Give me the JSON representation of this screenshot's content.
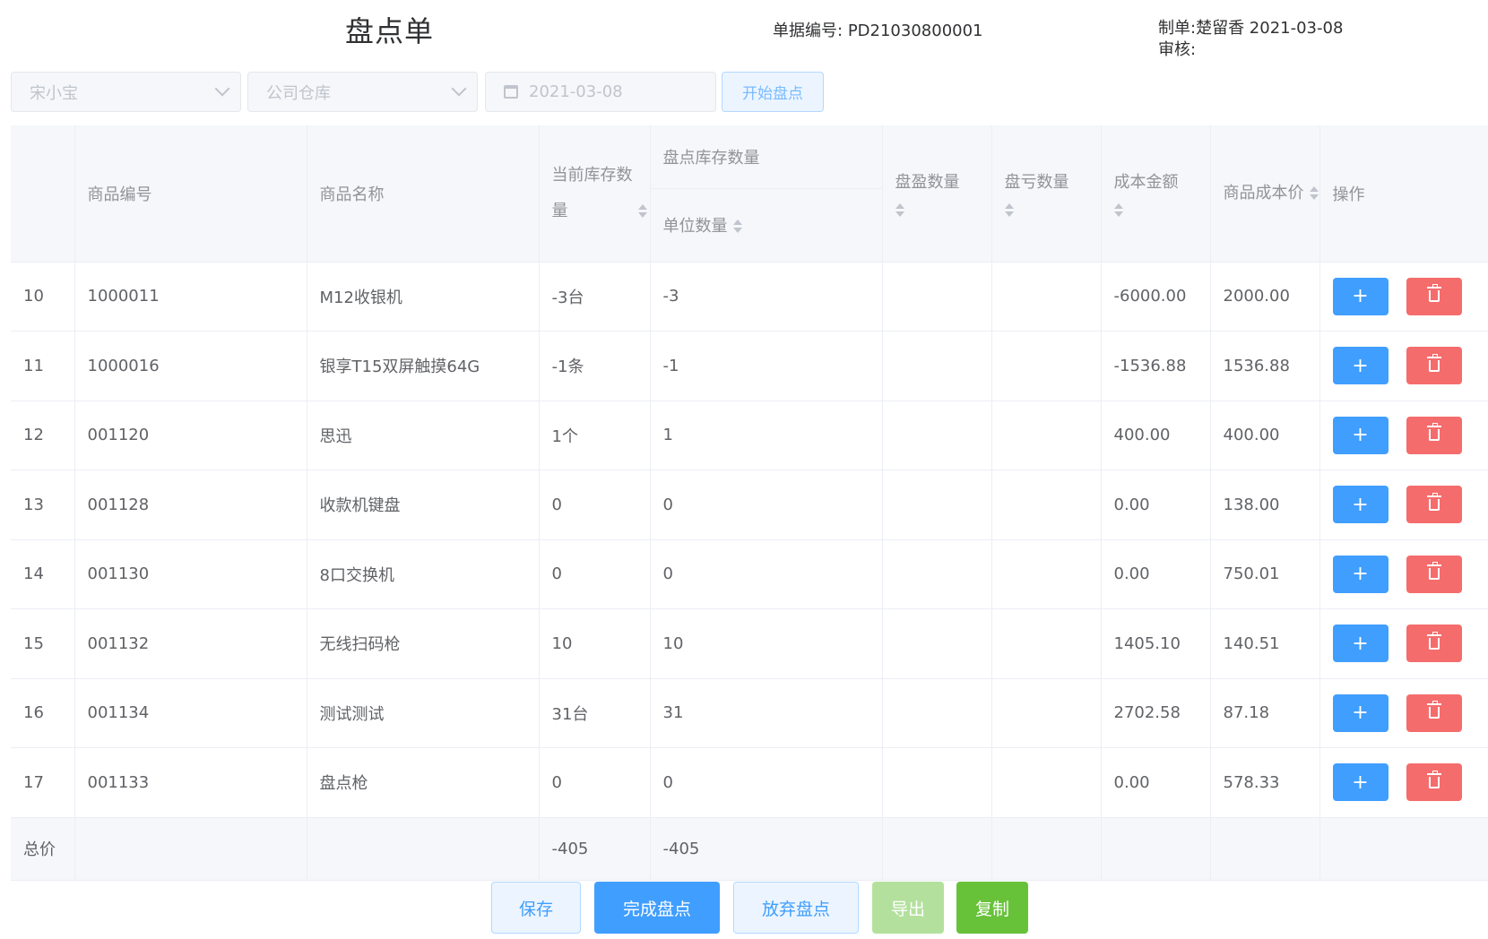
{
  "header": {
    "title": "盘点单",
    "doc_no_label": "单据编号:",
    "doc_no": "PD21030800001",
    "maker_label": "制单:",
    "maker": "楚留香 2021-03-08",
    "reviewer_label": "审核:"
  },
  "filters": {
    "person": "宋小宝",
    "warehouse": "公司仓库",
    "date": "2021-03-08",
    "start_label": "开始盘点"
  },
  "table": {
    "headers": {
      "code": "商品编号",
      "name": "商品名称",
      "current_stock": "当前库存数量",
      "count_group": "盘点库存数量",
      "unit_qty": "单位数量",
      "surplus": "盘盈数量",
      "loss": "盘亏数量",
      "cost_amount": "成本金额",
      "unit_cost": "商品成本价",
      "ops": "操作"
    },
    "rows": [
      {
        "idx": "10",
        "code": "1000011",
        "name": "M12收银机",
        "stock": "-3台",
        "unit": "-3",
        "surplus": "",
        "loss": "",
        "amount": "-6000.00",
        "cost": "2000.00"
      },
      {
        "idx": "11",
        "code": "1000016",
        "name": "银享T15双屏触摸64G",
        "stock": "-1条",
        "unit": "-1",
        "surplus": "",
        "loss": "",
        "amount": "-1536.88",
        "cost": "1536.88"
      },
      {
        "idx": "12",
        "code": "001120",
        "name": "思迅",
        "stock": "1个",
        "unit": "1",
        "surplus": "",
        "loss": "",
        "amount": "400.00",
        "cost": "400.00"
      },
      {
        "idx": "13",
        "code": "001128",
        "name": "收款机键盘",
        "stock": "0",
        "unit": "0",
        "surplus": "",
        "loss": "",
        "amount": "0.00",
        "cost": "138.00"
      },
      {
        "idx": "14",
        "code": "001130",
        "name": "8口交换机",
        "stock": "0",
        "unit": "0",
        "surplus": "",
        "loss": "",
        "amount": "0.00",
        "cost": "750.01"
      },
      {
        "idx": "15",
        "code": "001132",
        "name": "无线扫码枪",
        "stock": "10",
        "unit": "10",
        "surplus": "",
        "loss": "",
        "amount": "1405.10",
        "cost": "140.51"
      },
      {
        "idx": "16",
        "code": "001134",
        "name": "测试测试",
        "stock": "31台",
        "unit": "31",
        "surplus": "",
        "loss": "",
        "amount": "2702.58",
        "cost": "87.18"
      },
      {
        "idx": "17",
        "code": "001133",
        "name": "盘点枪",
        "stock": "0",
        "unit": "0",
        "surplus": "",
        "loss": "",
        "amount": "0.00",
        "cost": "578.33"
      }
    ],
    "total": {
      "label": "总价",
      "stock": "-405",
      "unit": "-405"
    },
    "add_icon": "plus-icon",
    "delete_icon": "trash-icon"
  },
  "footer": {
    "save": "保存",
    "complete": "完成盘点",
    "abandon": "放弃盘点",
    "export": "导出",
    "copy": "复制"
  },
  "colors": {
    "primary": "#409eff",
    "danger": "#f56c6c",
    "success": "#67c23a"
  }
}
